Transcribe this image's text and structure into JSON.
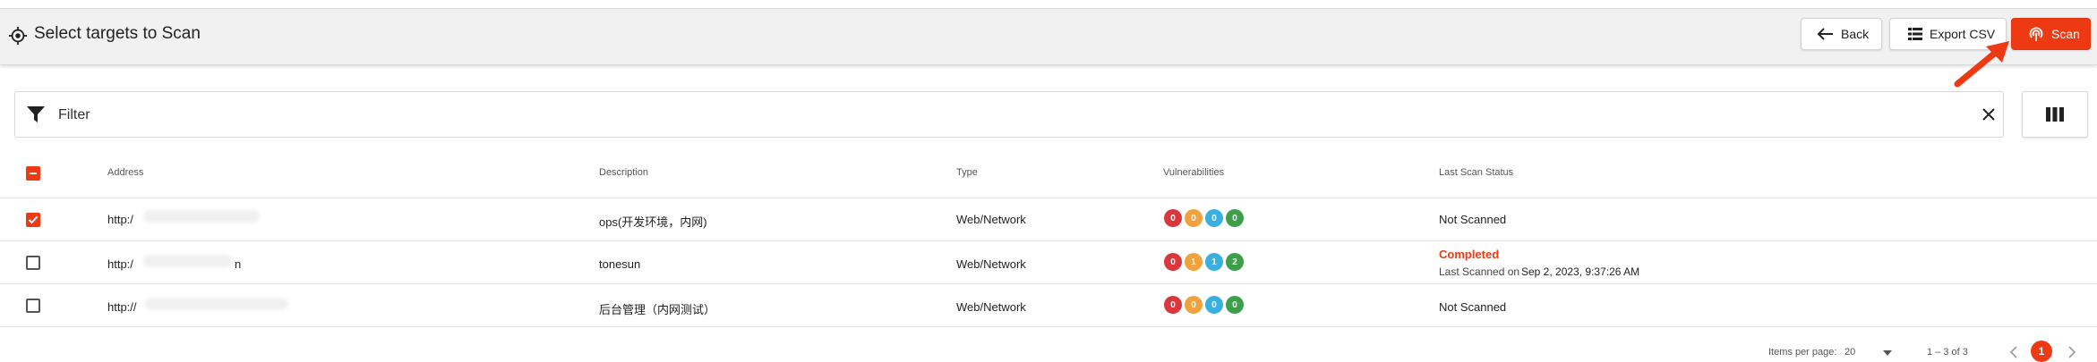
{
  "header": {
    "title": "Select targets to Scan",
    "back_label": "Back",
    "export_label": "Export CSV",
    "scan_label": "Scan"
  },
  "filter": {
    "label": "Filter"
  },
  "table": {
    "columns": [
      "Address",
      "Description",
      "Type",
      "Vulnerabilities",
      "Last Scan Status"
    ],
    "rows": [
      {
        "checked": true,
        "address": "http:/",
        "description": "ops(开发环境，内网)",
        "type": "Web/Network",
        "vulns": [
          "0",
          "0",
          "0",
          "0"
        ],
        "status": "Not Scanned",
        "status_sub_prefix": "",
        "status_sub_date": ""
      },
      {
        "checked": false,
        "address": "http:/",
        "address_suffix": "n",
        "description": "tonesun",
        "type": "Web/Network",
        "vulns": [
          "0",
          "1",
          "1",
          "2"
        ],
        "status": "Completed",
        "status_sub_prefix": "Last Scanned on",
        "status_sub_date": "Sep 2, 2023, 9:37:26 AM"
      },
      {
        "checked": false,
        "address": "http://",
        "description": "后台管理（内网测试）",
        "type": "Web/Network",
        "vulns": [
          "0",
          "0",
          "0",
          "0"
        ],
        "status": "Not Scanned",
        "status_sub_prefix": "",
        "status_sub_date": ""
      }
    ]
  },
  "vuln_colors": [
    "#d9363e",
    "#f0a23c",
    "#3ab0e2",
    "#3d9f4a"
  ],
  "accent_color": "#ee3a12",
  "pagination": {
    "items_per_page_label": "Items per page:",
    "items_per_page_value": "20",
    "range": "1 – 3 of 3",
    "current_page": "1"
  }
}
